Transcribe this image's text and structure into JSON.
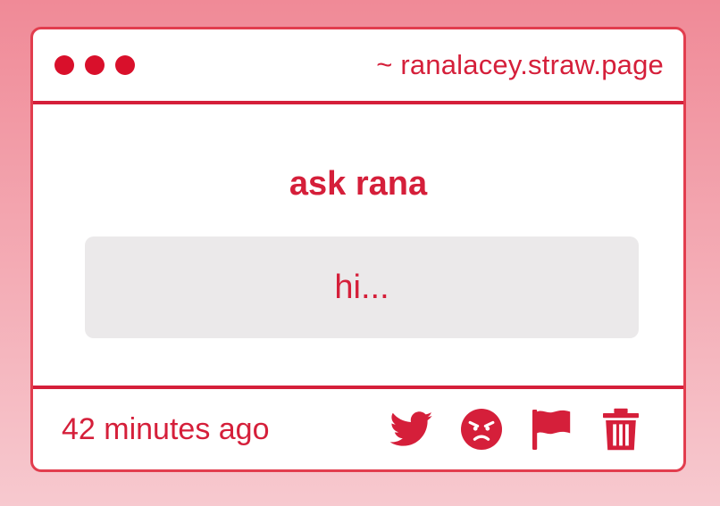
{
  "window": {
    "url": "~ ranalacey.straw.page"
  },
  "card": {
    "title": "ask rana",
    "message": "hi..."
  },
  "footer": {
    "timestamp": "42 minutes ago",
    "actions": [
      {
        "icon": "twitter-icon"
      },
      {
        "icon": "angry-face-icon"
      },
      {
        "icon": "flag-icon"
      },
      {
        "icon": "trash-icon"
      }
    ]
  },
  "colors": {
    "accent": "#d51f3a",
    "border": "#e23d4e",
    "message_bg": "#ebe9ea",
    "background_top": "#f08a97",
    "background_bottom": "#f7c9cf"
  }
}
